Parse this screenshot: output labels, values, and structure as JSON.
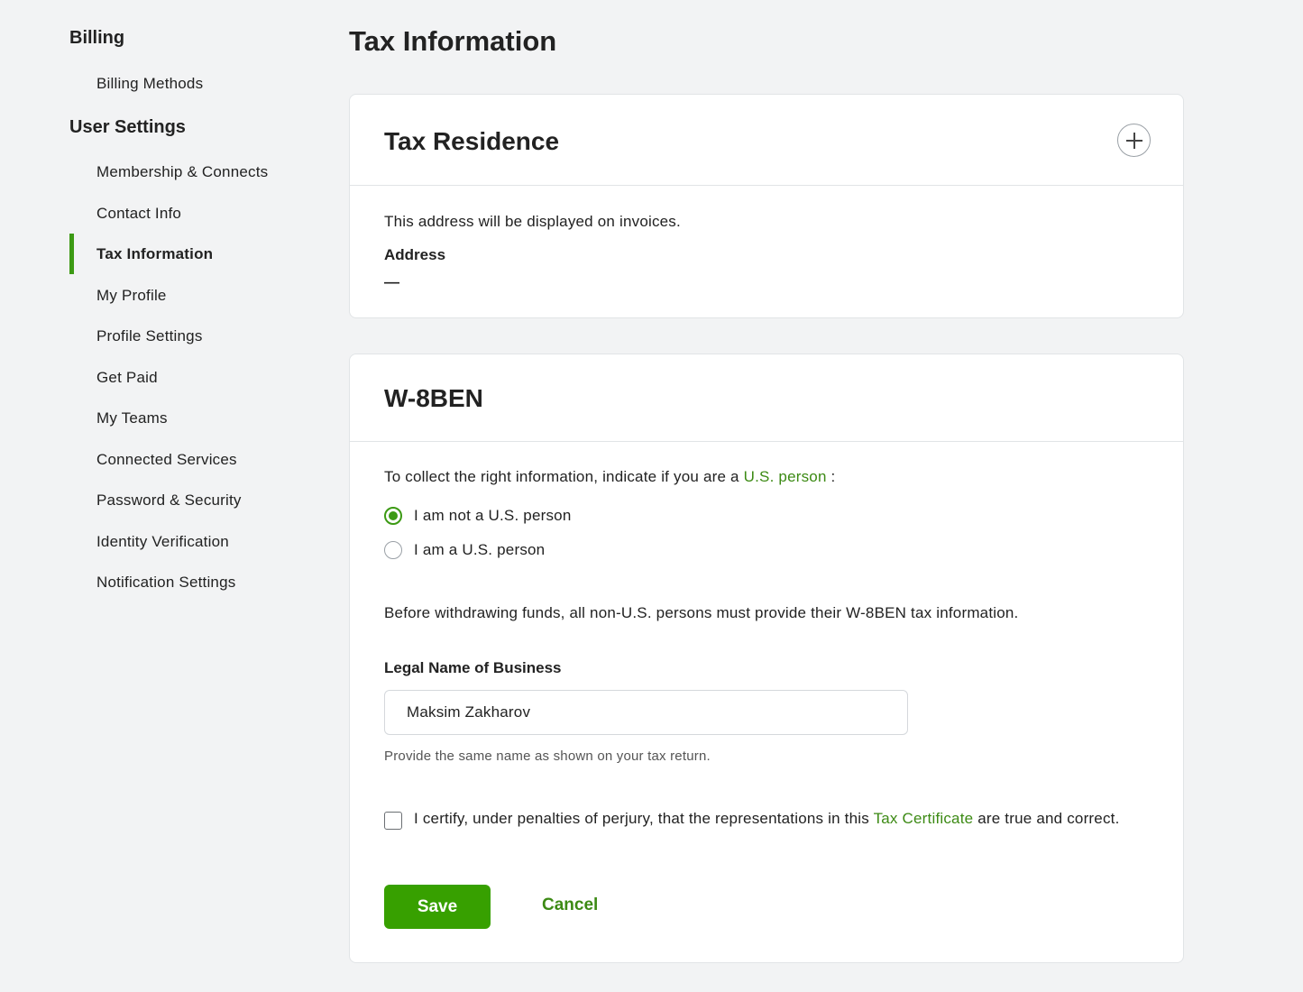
{
  "sidebar": {
    "billing_title": "Billing",
    "billing_items": [
      {
        "label": "Billing Methods"
      }
    ],
    "user_settings_title": "User Settings",
    "user_items": [
      {
        "label": "Membership & Connects"
      },
      {
        "label": "Contact Info"
      },
      {
        "label": "Tax Information",
        "active": true
      },
      {
        "label": "My Profile"
      },
      {
        "label": "Profile Settings"
      },
      {
        "label": "Get Paid"
      },
      {
        "label": "My Teams"
      },
      {
        "label": "Connected Services"
      },
      {
        "label": "Password & Security"
      },
      {
        "label": "Identity Verification"
      },
      {
        "label": "Notification Settings"
      }
    ],
    "active_color": "#3c9a14"
  },
  "page": {
    "title": "Tax Information"
  },
  "tax_residence": {
    "title": "Tax Residence",
    "add_icon": "plus-icon",
    "description": "This address will be displayed on invoices.",
    "address_label": "Address",
    "address_value": "—"
  },
  "w8ben": {
    "title": "W-8BEN",
    "prompt_prefix": "To collect the right information, indicate if you are a",
    "prompt_link": "U.S. person",
    "prompt_suffix": ":",
    "options": [
      {
        "label": "I am not a U.S. person",
        "checked": true
      },
      {
        "label": "I am a U.S. person",
        "checked": false
      }
    ],
    "notice": "Before withdrawing funds, all non-U.S. persons must provide their W-8BEN tax information.",
    "legal_name_label": "Legal Name of Business",
    "legal_name_value": "Maksim Zakharov",
    "legal_name_helper": "Provide the same name as shown on your tax return.",
    "certify_prefix": "I certify, under penalties of perjury, that the representations in this",
    "certify_link": "Tax Certificate",
    "certify_suffix": "are true and correct.",
    "certify_checked": false,
    "save_label": "Save",
    "cancel_label": "Cancel"
  },
  "colors": {
    "accent": "#37a000",
    "link": "#3c8a14",
    "background": "#f2f3f4"
  }
}
